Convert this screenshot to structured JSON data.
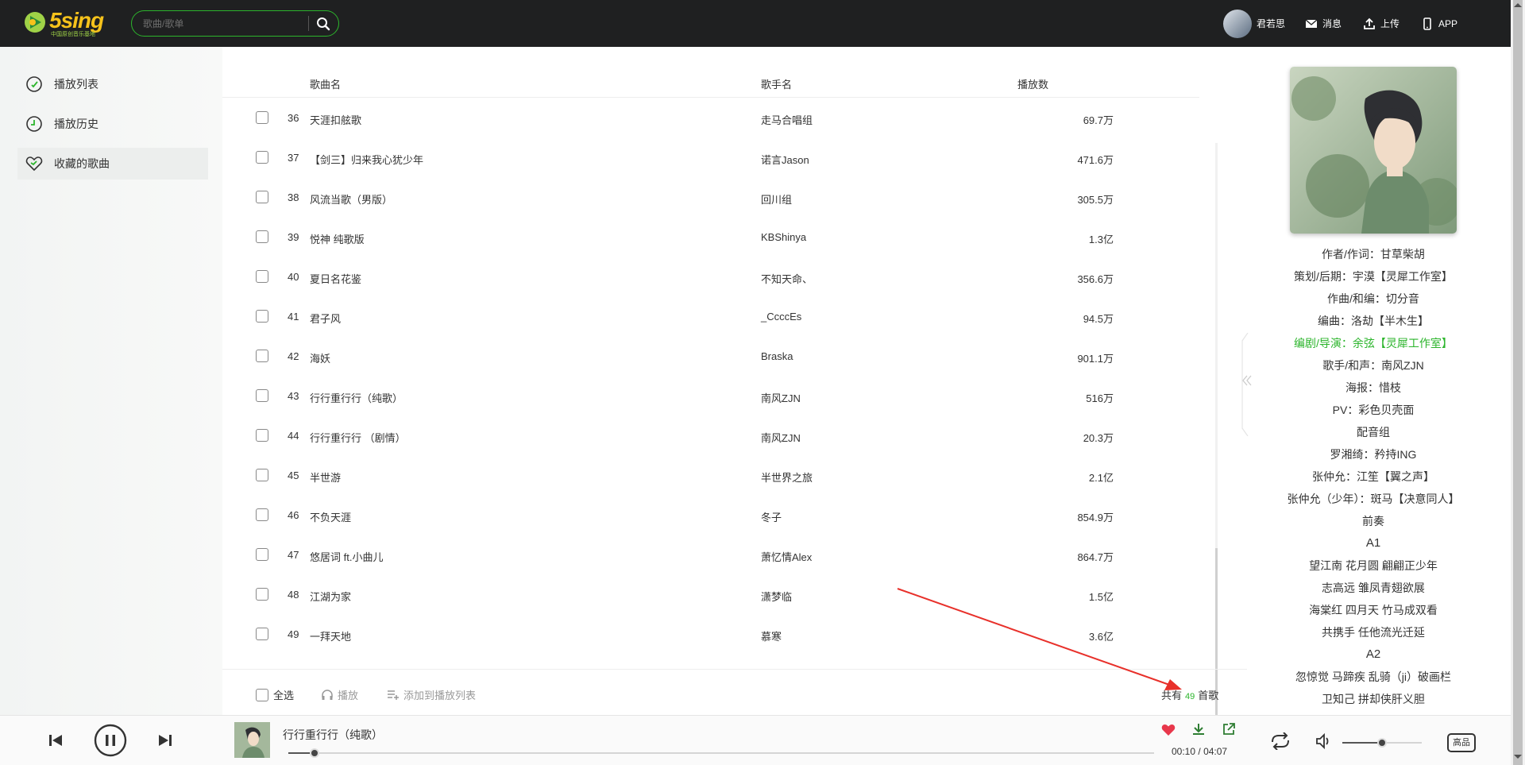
{
  "header": {
    "logo_text": "5sing",
    "logo_sub": "中国原创音乐基地",
    "search_placeholder": "歌曲/歌单",
    "user_name": "君若思",
    "messages_label": "消息",
    "upload_label": "上传",
    "app_label": "APP"
  },
  "sidebar": {
    "items": [
      {
        "label": "播放列表",
        "icon": "playlist-icon"
      },
      {
        "label": "播放历史",
        "icon": "clock-icon"
      },
      {
        "label": "收藏的歌曲",
        "icon": "heart-icon"
      }
    ]
  },
  "table": {
    "headers": {
      "name": "歌曲名",
      "singer": "歌手名",
      "plays": "播放数"
    },
    "rows": [
      {
        "num": "36",
        "name": "天涯扣舷歌",
        "singer": "走马合唱组",
        "plays": "69.7万"
      },
      {
        "num": "37",
        "name": "【剑三】归来我心犹少年",
        "singer": "诺言Jason",
        "plays": "471.6万"
      },
      {
        "num": "38",
        "name": "风流当歌（男版）",
        "singer": "回川组",
        "plays": "305.5万"
      },
      {
        "num": "39",
        "name": "悦神 纯歌版",
        "singer": "KBShinya",
        "plays": "1.3亿"
      },
      {
        "num": "40",
        "name": "夏日名花鉴",
        "singer": "不知天命、",
        "plays": "356.6万"
      },
      {
        "num": "41",
        "name": "君子风",
        "singer": "_CcccEs",
        "plays": "94.5万"
      },
      {
        "num": "42",
        "name": "海妖",
        "singer": "Braska",
        "plays": "901.1万"
      },
      {
        "num": "43",
        "name": "行行重行行（纯歌）",
        "singer": "南风ZJN",
        "plays": "516万"
      },
      {
        "num": "44",
        "name": "行行重行行 （剧情）",
        "singer": "南风ZJN",
        "plays": "20.3万"
      },
      {
        "num": "45",
        "name": "半世游",
        "singer": "半世界之旅",
        "plays": "2.1亿"
      },
      {
        "num": "46",
        "name": "不负天涯",
        "singer": "冬子",
        "plays": "854.9万"
      },
      {
        "num": "47",
        "name": "悠居词 ft.小曲儿",
        "singer": "萧忆情Alex",
        "plays": "864.7万"
      },
      {
        "num": "48",
        "name": "江湖为家",
        "singer": "潇梦临",
        "plays": "1.5亿"
      },
      {
        "num": "49",
        "name": "一拜天地",
        "singer": "慕寒",
        "plays": "3.6亿"
      }
    ],
    "footer": {
      "select_all": "全选",
      "play": "播放",
      "add_to_playlist": "添加到播放列表",
      "count_prefix": "共有",
      "count": "49",
      "count_suffix": "首歌"
    }
  },
  "lyrics": [
    "作者/作词：甘草柴胡",
    "策划/后期：宇漠【灵犀工作室】",
    "作曲/和编：切分音",
    "编曲：洛劫【半木生】",
    "编剧/导演：余弦【灵犀工作室】",
    "歌手/和声：南风ZJN",
    "海报：惜枝",
    "PV：彩色贝壳面",
    "配音组",
    "罗湘绮：矜持ING",
    "张仲允：江笙【翼之声】",
    "张仲允（少年）：斑马【决意同人】",
    "前奏",
    "A1",
    "望江南 花月圆 翩翩正少年",
    "志高远 雏凤青翅欲展",
    "海棠红 四月天 竹马成双看",
    "共携手 任他流光迁延",
    "A2",
    "忽惊觉 马蹄疾 乱骑（ji）破画栏",
    "卫知己 拼却侠肝义胆"
  ],
  "player": {
    "title": "行行重行行（纯歌）",
    "time_current": "00:10",
    "time_separator": "/",
    "time_total": "04:07",
    "progress": 0.03,
    "volume": 0.5,
    "quality": "高品"
  },
  "colors": {
    "accent": "#2cb52c",
    "header_bg": "#1f2021",
    "favorite": "#e8374b"
  }
}
